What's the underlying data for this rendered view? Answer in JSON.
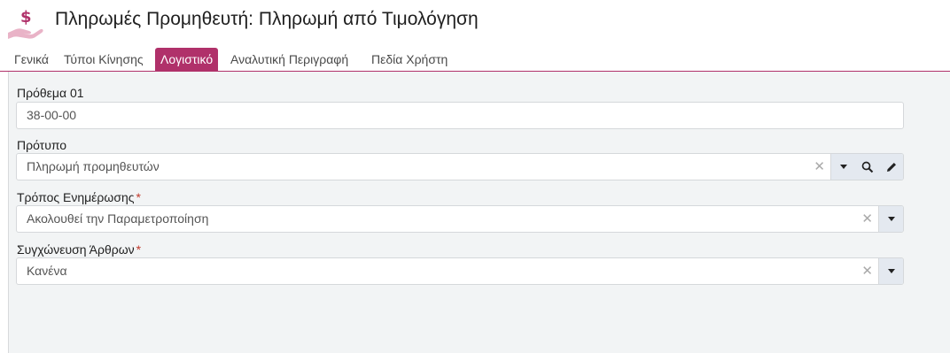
{
  "header": {
    "title": "Πληρωμές Προμηθευτή: Πληρωμή από Τιμολόγηση",
    "icon": "money-hand-icon",
    "icon_color": "#b0316a"
  },
  "tabs": [
    {
      "label": "Γενικά",
      "active": false
    },
    {
      "label": "Τύποι Κίνησης",
      "active": false
    },
    {
      "label": "Λογιστικό",
      "active": true
    },
    {
      "label": "Αναλυτική Περιγραφή",
      "active": false
    },
    {
      "label": "Πεδία Χρήστη",
      "active": false
    }
  ],
  "form": {
    "prefix": {
      "label": "Πρόθεμα 01",
      "value": "38-00-00"
    },
    "template": {
      "label": "Πρότυπο",
      "value": "Πληρωμή προμηθευτών"
    },
    "update_mode": {
      "label": "Τρόπος Ενημέρωσης",
      "required_mark": "*",
      "value": "Ακολουθεί την Παραμετροποίηση"
    },
    "merge_entries": {
      "label": "Συγχώνευση Άρθρων",
      "required_mark": "*",
      "value": "Κανένα"
    }
  },
  "colors": {
    "accent": "#b0316a",
    "content_bg": "#f2f4f5",
    "button_strip": "#e4e9f0",
    "required": "#c0392b"
  }
}
